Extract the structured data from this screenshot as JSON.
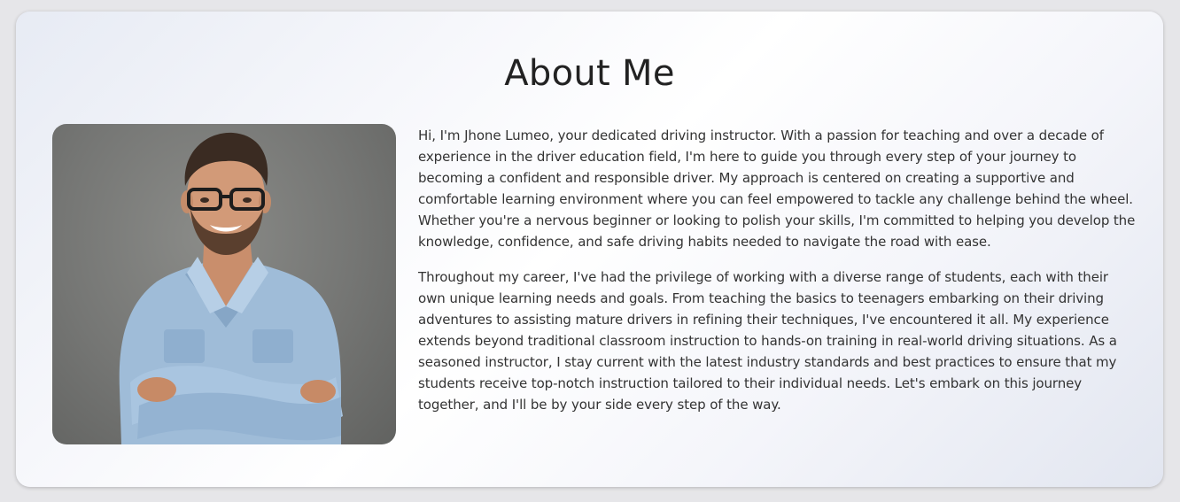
{
  "about": {
    "title": "About Me",
    "paragraphs": [
      "Hi, I'm Jhone Lumeo, your dedicated driving instructor. With a passion for teaching and over a decade of experience in the driver education field, I'm here to guide you through every step of your journey to becoming a confident and responsible driver. My approach is centered on creating a supportive and comfortable learning environment where you can feel empowered to tackle any challenge behind the wheel. Whether you're a nervous beginner or looking to polish your skills, I'm committed to helping you develop the knowledge, confidence, and safe driving habits needed to navigate the road with ease.",
      "Throughout my career, I've had the privilege of working with a diverse range of students, each with their own unique learning needs and goals. From teaching the basics to teenagers embarking on their driving adventures to assisting mature drivers in refining their techniques, I've encountered it all. My experience extends beyond traditional classroom instruction to hands-on training in real-world driving situations. As a seasoned instructor, I stay current with the latest industry standards and best practices to ensure that my students receive top-notch instruction tailored to their individual needs. Let's embark on this journey together, and I'll be by your side every step of the way."
    ]
  }
}
